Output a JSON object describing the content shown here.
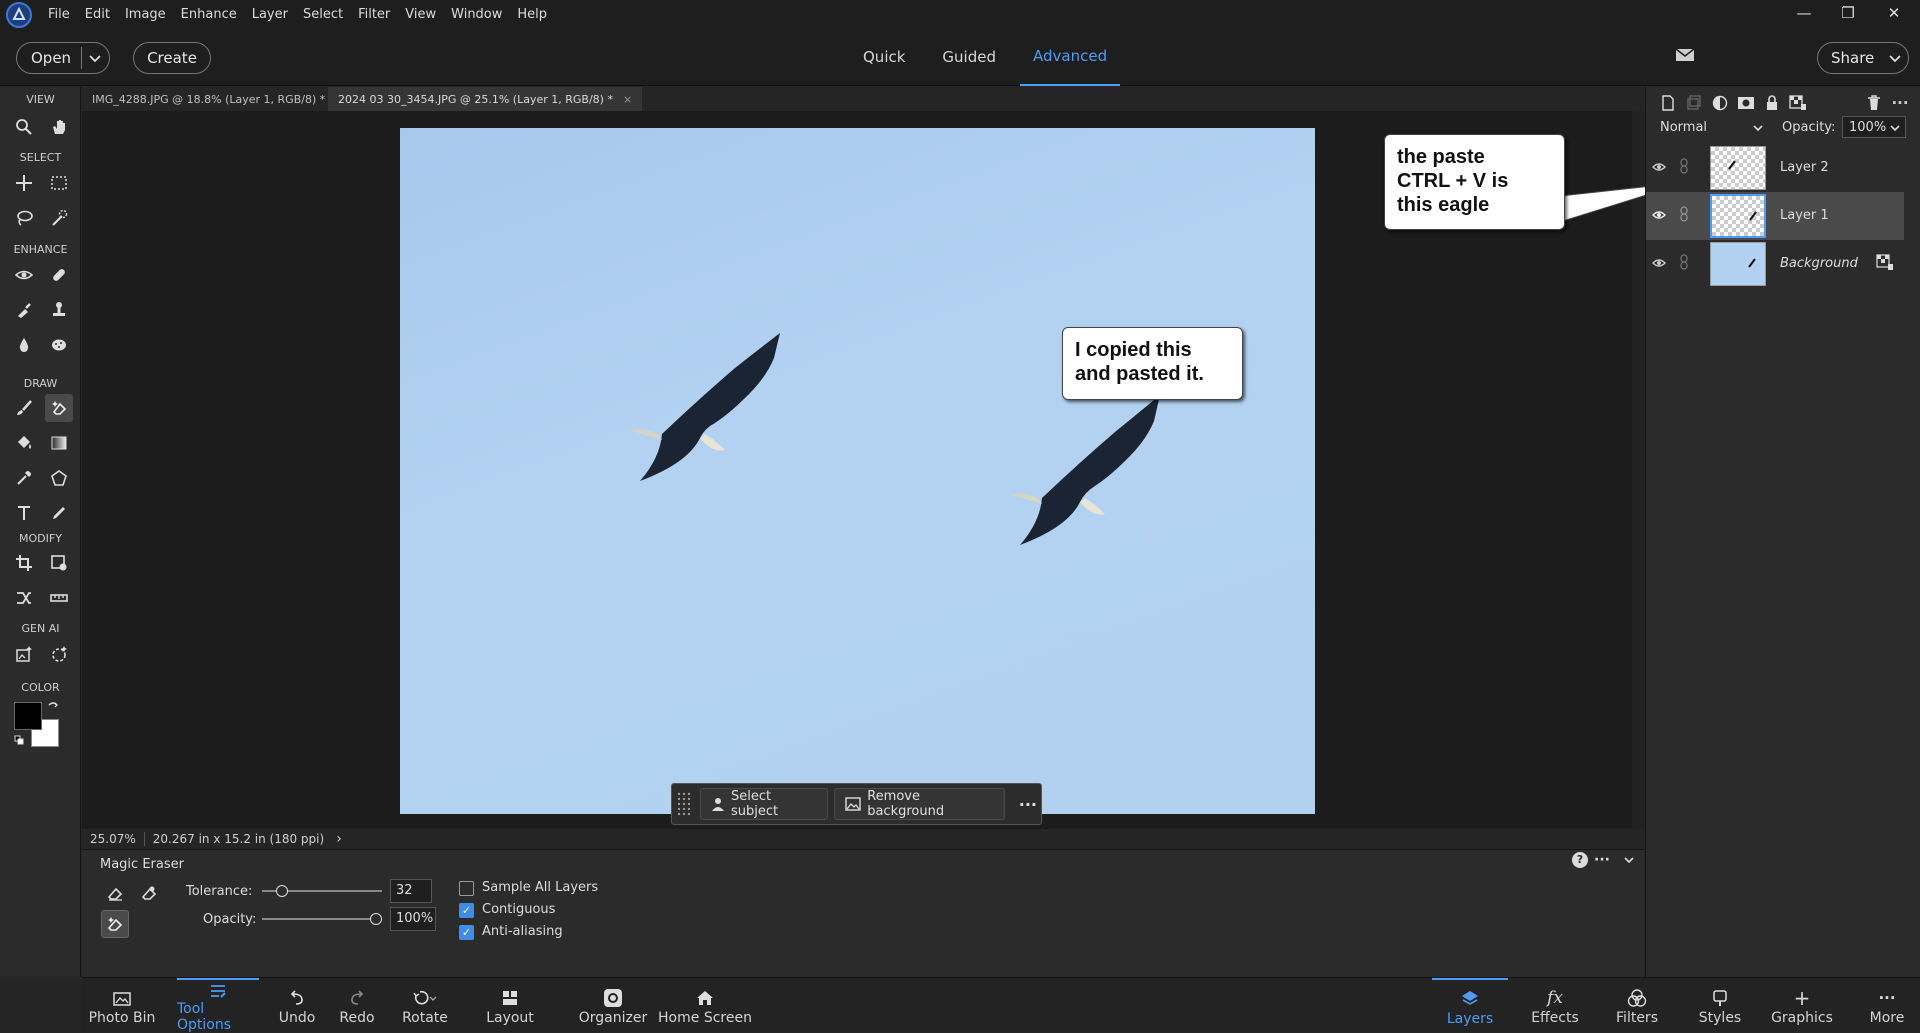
{
  "menu": [
    "File",
    "Edit",
    "Image",
    "Enhance",
    "Layer",
    "Select",
    "Filter",
    "View",
    "Window",
    "Help"
  ],
  "window_controls": {
    "minimize": "—",
    "restore": "❐",
    "close": "✕"
  },
  "topbar": {
    "open_label": "Open",
    "create_label": "Create",
    "share_label": "Share",
    "modes": [
      "Quick",
      "Guided",
      "Advanced"
    ],
    "active_mode": "Advanced"
  },
  "toolbar": {
    "sections": {
      "view": "VIEW",
      "select": "SELECT",
      "enhance": "ENHANCE",
      "draw": "DRAW",
      "modify": "MODIFY",
      "gen_ai": "GEN AI",
      "color": "COLOR"
    },
    "foreground_color": "#000000",
    "background_color": "#ffffff",
    "active_tool": "magic-eraser"
  },
  "doc_tabs": [
    {
      "title": "IMG_4288.JPG @ 18.8% (Layer 1, RGB/8) *",
      "close": "×"
    },
    {
      "title": "2024 03 30_3454.JPG @ 25.1% (Layer 1, RGB/8) *",
      "close": "×"
    }
  ],
  "canvas": {
    "callout_1": [
      "the paste",
      "CTRL + V is",
      "this eagle"
    ],
    "callout_2": [
      "I copied this",
      "and pasted it."
    ]
  },
  "floating_bar": {
    "select_subject": "Select subject",
    "remove_background": "Remove background",
    "more": "···"
  },
  "status": {
    "zoom": "25.07%",
    "doc_size": "20.267 in x 15.2 in (180 ppi)",
    "arrow": "›"
  },
  "tool_options": {
    "tool_name": "Magic Eraser",
    "tolerance_label": "Tolerance:",
    "tolerance_value": "32",
    "tolerance_fraction": 0.125,
    "opacity_label": "Opacity:",
    "opacity_value": "100%",
    "opacity_fraction": 1.0,
    "sample_all_layers": {
      "label": "Sample All Layers",
      "checked": false
    },
    "contiguous": {
      "label": "Contiguous",
      "checked": true
    },
    "anti_aliasing": {
      "label": "Anti-aliasing",
      "checked": true
    },
    "help": "?",
    "more": "···"
  },
  "bottom_bar": {
    "left": [
      "Photo Bin",
      "Tool Options",
      "Undo",
      "Redo",
      "Rotate",
      "Layout",
      "Organizer",
      "Home Screen"
    ],
    "right": [
      "Layers",
      "Effects",
      "Filters",
      "Styles",
      "Graphics",
      "More"
    ],
    "active_left": "Tool Options",
    "active_right": "Layers"
  },
  "layers_panel": {
    "blend_mode": "Normal",
    "opacity_label": "Opacity:",
    "opacity_value": "100%",
    "layers": [
      {
        "name": "Layer 2",
        "selected": false
      },
      {
        "name": "Layer 1",
        "selected": true
      },
      {
        "name": "Background",
        "selected": false
      }
    ]
  },
  "colors": {
    "accent": "#4e9cf5",
    "sky": "#b2d1f1",
    "eagle": "#1b2433"
  }
}
